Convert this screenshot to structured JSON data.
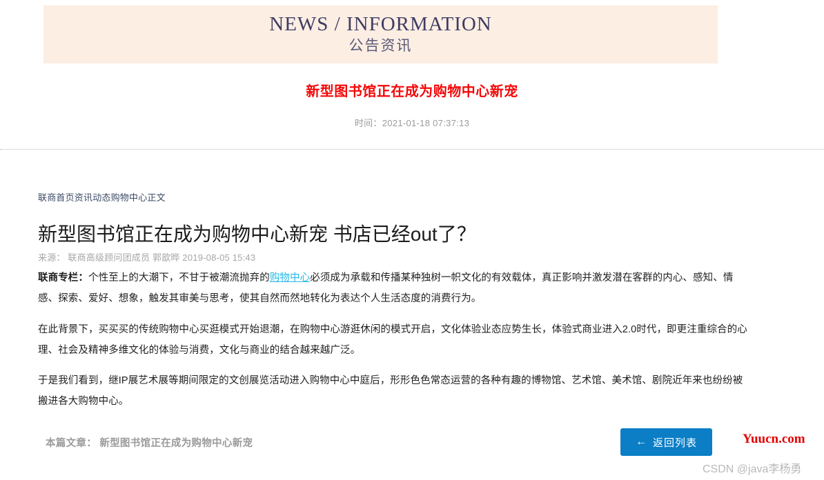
{
  "banner": {
    "english_title": "NEWS / INFORMATION",
    "chinese_title": "公告资讯",
    "background_color": "#fceee3",
    "text_color": "#3f3c63"
  },
  "article_head": {
    "red_title": "新型图书馆正在成为购物中心新宠",
    "red_title_color": "#f40808",
    "time_label": "时间：",
    "time_value": "2021-01-18 07:37:13",
    "time_full": "时间：2021-01-18 07:37:13"
  },
  "content": {
    "breadcrumb": "联商首页资讯动态购物中心正文",
    "main_title": "新型图书馆正在成为购物中心新宠 书店已经out了？",
    "source_label": "来源：",
    "source_value": "联商高级顾问团成员 郭歆晔 2019-08-05 15:43",
    "source_full": "来源： 联商高级顾问团成员 郭歆晔 2019-08-05 15:43",
    "paragraphs": [
      {
        "lead": "联商专栏：",
        "text_before_link": "个性至上的大潮下，不甘于被潮流抛弃的",
        "link_text": "购物中心",
        "link_color": "#25b9e8",
        "text_after_link": "必须成为承载和传播某种独树一帜文化的有效载体，真正影响并激发潜在客群的内心、感知、情感、探索、爱好、想象，触发其审美与思考，使其自然而然地转化为表达个人生活态度的消费行为。"
      },
      {
        "text": "在此背景下，买买买的传统购物中心买逛模式开始退潮，在购物中心游逛休闲的模式开启，文化体验业态应势生长，体验式商业进入2.0时代，即更注重综合的心理、社会及精神多维文化的体验与消费，文化与商业的结合越来越广泛。"
      },
      {
        "text": "于是我们看到，继IP展艺术展等期间限定的文创展览活动进入购物中心中庭后，形形色色常态运营的各种有趣的博物馆、艺术馆、美术馆、剧院近年来也纷纷被搬进各大购物中心。"
      }
    ]
  },
  "footer": {
    "note_label": "本篇文章：",
    "note_value": "新型图书馆正在成为购物中心新宠",
    "note_full": "本篇文章： 新型图书馆正在成为购物中心新宠",
    "back_button_label": "返回列表",
    "back_button_icon": "arrow-left-icon",
    "back_button_arrow": "←",
    "back_button_color": "#0b7ec6"
  },
  "watermarks": {
    "site": "Yuucn.com",
    "site_color": "#e10000",
    "credit": "CSDN @java李杨勇",
    "credit_color": "#b9b9b9"
  }
}
